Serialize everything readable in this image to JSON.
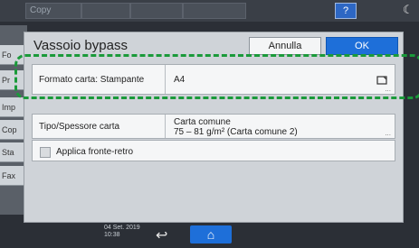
{
  "topbar": {
    "app_label": "Copy",
    "help_label": "?",
    "moon_icon": "moon-icon"
  },
  "bg_tabs": [
    "Fo",
    "Pr",
    "Imp",
    "Cop",
    "Sta",
    "Fax"
  ],
  "dialog": {
    "title": "Vassoio bypass",
    "cancel_label": "Annulla",
    "ok_label": "OK",
    "rows": [
      {
        "label": "Formato carta: Stampante",
        "value": "A4",
        "icon": "paper-icon",
        "more": "..."
      },
      {
        "label": "Tipo/Spessore carta",
        "value_line1": "Carta comune",
        "value_line2": "75 – 81 g/m² (Carta comune 2)",
        "more": "..."
      },
      {
        "label": "Applica fronte-retro"
      }
    ]
  },
  "footer": {
    "date": "04 Set. 2019",
    "time": "10:38",
    "back_icon": "back-icon",
    "home_icon": "home-icon"
  },
  "colors": {
    "ok_button": "#1e6fd9",
    "highlight": "#1a9a3a"
  }
}
